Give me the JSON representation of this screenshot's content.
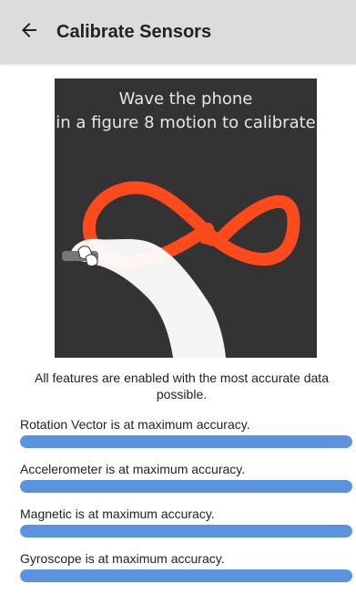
{
  "toolbar": {
    "title": "Calibrate Sensors",
    "back_icon": "arrow-back-icon"
  },
  "illustration": {
    "line1": "Wave the phone",
    "line2": "in a figure 8 motion to calibrate",
    "colors": {
      "background": "#333333",
      "figure_eight": "#ff4a1c",
      "hand": "#ffffff"
    }
  },
  "summary": "All features are enabled with the most accurate data possible.",
  "sensors": [
    {
      "label": "Rotation Vector is at maximum accuracy.",
      "accuracy": 1.0
    },
    {
      "label": "Accelerometer is at maximum accuracy.",
      "accuracy": 1.0
    },
    {
      "label": "Magnetic is at maximum accuracy.",
      "accuracy": 1.0
    },
    {
      "label": "Gyroscope is at maximum accuracy.",
      "accuracy": 1.0
    }
  ],
  "colors": {
    "toolbar": "#dcdcdc",
    "accuracy_bar": "#5b93e0"
  }
}
